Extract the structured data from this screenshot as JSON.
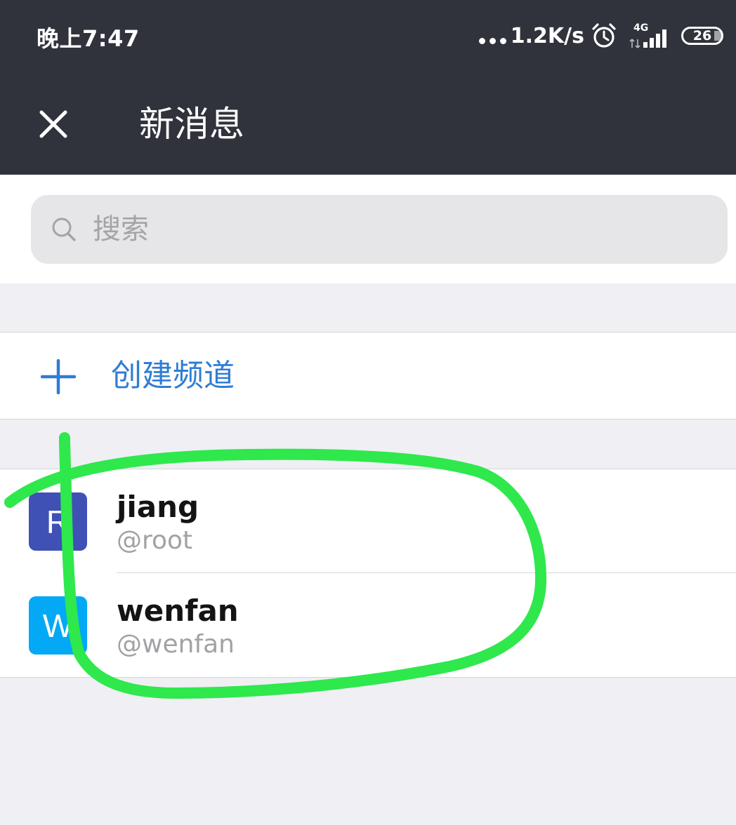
{
  "status_bar": {
    "time": "晚上7:47",
    "net_speed": "1.2K/s",
    "network_type": "4G",
    "battery": "26"
  },
  "nav": {
    "title": "新消息",
    "close_icon": "close-icon"
  },
  "search": {
    "placeholder": "搜索",
    "value": ""
  },
  "create_channel": {
    "label": "创建频道",
    "icon": "plus-icon"
  },
  "users": [
    {
      "avatar_letter": "R",
      "avatar_color": "#3f51b5",
      "name": "jiang",
      "handle": "@root"
    },
    {
      "avatar_letter": "W",
      "avatar_color": "#03a9f4",
      "name": "wenfan",
      "handle": "@wenfan"
    }
  ],
  "colors": {
    "header_bg": "#30333c",
    "accent": "#2f7dd3",
    "annotation": "#2ee84c",
    "page_bg": "#efeff4"
  }
}
